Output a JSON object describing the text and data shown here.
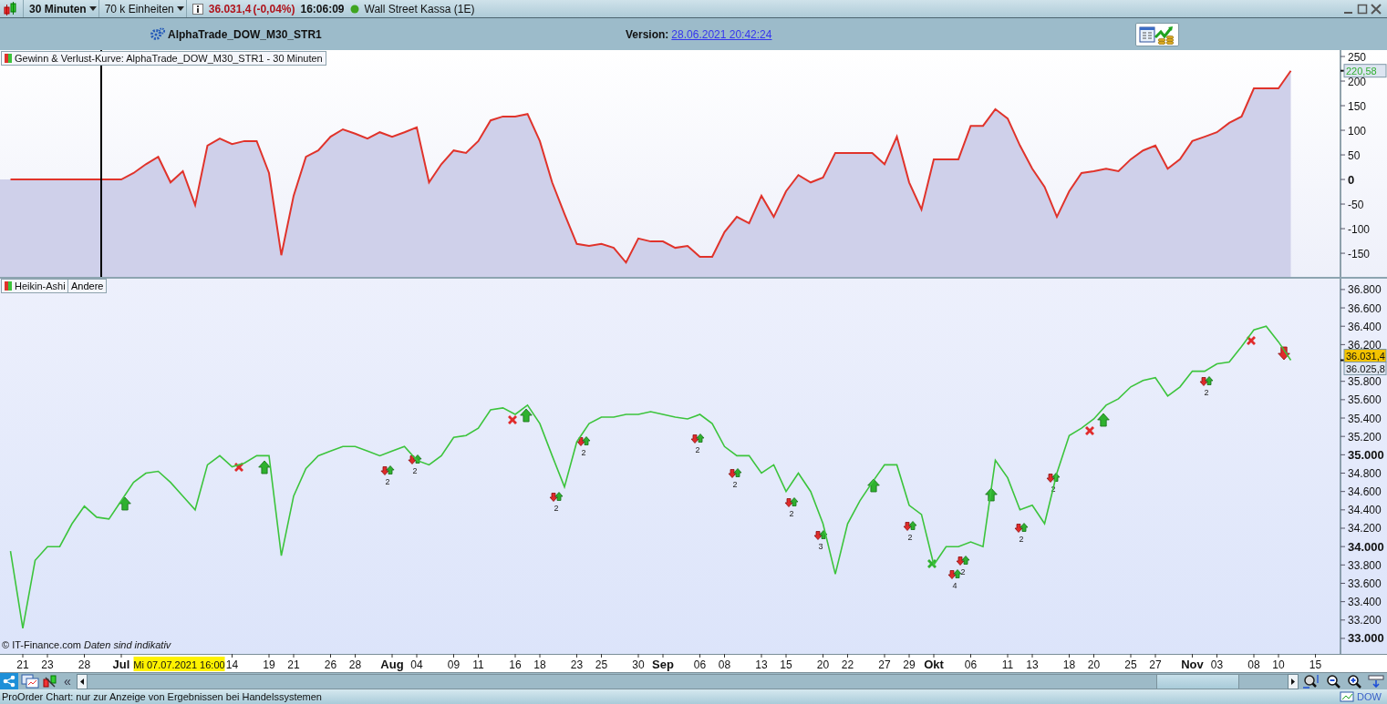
{
  "toolbar": {
    "timeframe": "30 Minuten",
    "units": "70 k Einheiten",
    "price": "36.031,4",
    "change": "(-0,04%)",
    "time": "16:06:09",
    "market_open": true,
    "instrument": "Wall Street Kassa (1E)"
  },
  "header": {
    "system": "AlphaTrade_DOW_M30_STR1",
    "version_label": "Version:",
    "version_link": "28.06.2021 20:42:24"
  },
  "equity_panel": {
    "legend": "Gewinn & Verlust-Kurve: AlphaTrade_DOW_M30_STR1 - 30 Minuten",
    "price_tags": [
      {
        "kind": "value_tag",
        "text": "220,58"
      }
    ],
    "chart_data": {
      "type": "area",
      "ylim": [
        -198,
        263
      ],
      "yticks": [
        250,
        200,
        150,
        100,
        50,
        0,
        -50,
        -100,
        -150
      ],
      "series": [
        {
          "color": "#e0332b",
          "values": [
            0,
            0,
            0,
            0,
            0,
            0,
            0,
            0,
            0,
            0,
            13,
            31,
            46,
            -6,
            17,
            -52,
            69,
            83,
            72,
            78,
            78,
            13,
            -154,
            -33,
            46,
            59,
            87,
            102,
            93,
            83,
            96,
            87,
            96,
            106,
            -6,
            31,
            59,
            54,
            78,
            120,
            128,
            128,
            133,
            78,
            -6,
            -70,
            -131,
            -135,
            -131,
            -139,
            -169,
            -120,
            -126,
            -126,
            -139,
            -135,
            -157,
            -157,
            -107,
            -76,
            -89,
            -33,
            -76,
            -24,
            9,
            -6,
            4,
            54,
            54,
            54,
            54,
            31,
            87,
            -6,
            -61,
            41,
            41,
            41,
            109,
            109,
            143,
            124,
            69,
            22,
            -15,
            -76,
            -24,
            13,
            17,
            22,
            17,
            41,
            59,
            69,
            22,
            41,
            78,
            87,
            96,
            115,
            128,
            185,
            185,
            185,
            221
          ]
        }
      ]
    }
  },
  "price_panel": {
    "other_button": "Andere",
    "copyright": "© IT-Finance.com",
    "disclaimer": "Daten sind indikativ",
    "date_cursor": {
      "text": "Mi 07.07.2021 16:00"
    },
    "price_tags": [
      {
        "kind": "last_price",
        "text": "36.031,4"
      },
      {
        "kind": "value_tag",
        "text": "36.025,8"
      }
    ],
    "trade_signals": [
      {
        "kind": "long"
      },
      {
        "kind": "exit_red"
      },
      {
        "kind": "long"
      },
      {
        "kind": "cluster",
        "text": "2"
      },
      {
        "kind": "cluster",
        "text": "2"
      },
      {
        "kind": "exit_red"
      },
      {
        "kind": "long"
      },
      {
        "kind": "cluster",
        "text": "2"
      },
      {
        "kind": "cluster",
        "text": "2"
      },
      {
        "kind": "cluster",
        "text": "2"
      },
      {
        "kind": "cluster",
        "text": "2"
      },
      {
        "kind": "cluster",
        "text": "2"
      },
      {
        "kind": "cluster",
        "text": "3"
      },
      {
        "kind": "long"
      },
      {
        "kind": "cluster",
        "text": "2"
      },
      {
        "kind": "exit_green"
      },
      {
        "kind": "cluster",
        "text": "4"
      },
      {
        "kind": "cluster",
        "text": "2"
      },
      {
        "kind": "long"
      },
      {
        "kind": "cluster",
        "text": "2"
      },
      {
        "kind": "cluster",
        "text": "2"
      },
      {
        "kind": "exit_red"
      },
      {
        "kind": "long"
      },
      {
        "kind": "cluster",
        "text": "2"
      },
      {
        "kind": "exit_red"
      },
      {
        "kind": "short"
      }
    ],
    "chart_data": {
      "type": "line",
      "ylim": [
        32831,
        36918
      ],
      "yticks": [
        {
          "value": 36800,
          "label": "36.800"
        },
        {
          "value": 36600,
          "label": "36.600"
        },
        {
          "value": 36400,
          "label": "36.400"
        },
        {
          "value": 36200,
          "label": "36.200"
        },
        {
          "value": 35800,
          "label": "35.800"
        },
        {
          "value": 35600,
          "label": "35.600"
        },
        {
          "value": 35400,
          "label": "35.400"
        },
        {
          "value": 35200,
          "label": "35.200"
        },
        {
          "value": 35000,
          "label": "35.000"
        },
        {
          "value": 34800,
          "label": "34.800"
        },
        {
          "value": 34600,
          "label": "34.600"
        },
        {
          "value": 34400,
          "label": "34.400"
        },
        {
          "value": 34200,
          "label": "34.200"
        },
        {
          "value": 34000,
          "label": "34.000"
        },
        {
          "value": 33800,
          "label": "33.800"
        },
        {
          "value": 33600,
          "label": "33.600"
        },
        {
          "value": 33400,
          "label": "33.400"
        },
        {
          "value": 33200,
          "label": "33.200"
        },
        {
          "value": 33000,
          "label": "33.000"
        }
      ],
      "categories": [
        null,
        "21",
        null,
        "23",
        null,
        null,
        "28",
        null,
        null,
        "Jul",
        null,
        null,
        null,
        null,
        null,
        null,
        null,
        null,
        "14",
        null,
        null,
        "19",
        null,
        "21",
        null,
        null,
        "26",
        null,
        "28",
        null,
        null,
        "Aug",
        null,
        "04",
        null,
        null,
        "09",
        null,
        "11",
        null,
        null,
        "16",
        null,
        "18",
        null,
        null,
        "23",
        null,
        "25",
        null,
        null,
        "30",
        null,
        "Sep",
        null,
        null,
        "06",
        null,
        "08",
        null,
        null,
        "13",
        null,
        "15",
        null,
        null,
        "20",
        null,
        "22",
        null,
        null,
        "27",
        null,
        "29",
        null,
        "Okt",
        null,
        null,
        "06",
        null,
        null,
        "11",
        null,
        "13",
        null,
        null,
        "18",
        null,
        "20",
        null,
        null,
        "25",
        null,
        "27",
        null,
        null,
        "Nov",
        null,
        "03",
        null,
        null,
        "08",
        null,
        "10",
        null,
        null,
        "15"
      ],
      "series": [
        {
          "name": "Heikin-Ashi",
          "color": "#3cc43c",
          "values": [
            33950,
            33110,
            33850,
            34000,
            34000,
            34250,
            34440,
            34320,
            34300,
            34500,
            34700,
            34800,
            34820,
            34700,
            34550,
            34400,
            34890,
            34990,
            34870,
            34910,
            34990,
            34990,
            33900,
            34550,
            34850,
            34990,
            35040,
            35090,
            35090,
            35040,
            34990,
            35040,
            35090,
            34940,
            34890,
            34990,
            35190,
            35210,
            35290,
            35490,
            35510,
            35440,
            35540,
            35340,
            34990,
            34650,
            35140,
            35340,
            35410,
            35410,
            35440,
            35440,
            35470,
            35440,
            35410,
            35390,
            35440,
            35340,
            35090,
            34990,
            34990,
            34800,
            34890,
            34600,
            34800,
            34600,
            34250,
            33700,
            34250,
            34500,
            34700,
            34890,
            34890,
            34450,
            34350,
            33800,
            34000,
            34000,
            34050,
            34000,
            34940,
            34750,
            34400,
            34450,
            34250,
            34800,
            35210,
            35290,
            35390,
            35540,
            35610,
            35740,
            35810,
            35840,
            35640,
            35740,
            35910,
            35910,
            35990,
            36010,
            36180,
            36360,
            36400,
            36230,
            36030,
            null,
            null
          ]
        }
      ]
    }
  },
  "scrollbar": {
    "collapse": "«"
  },
  "status_bar": {
    "text": "ProOrder Chart: nur zur Anzeige von Ergebnissen bei Handelssystemen",
    "symbol": "DOW"
  }
}
